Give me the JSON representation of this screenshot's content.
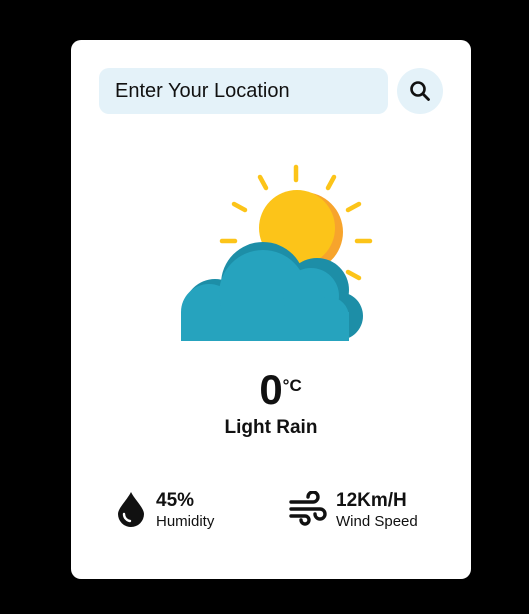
{
  "search": {
    "placeholder": "Enter Your Location",
    "icon": "search-icon"
  },
  "weather": {
    "icon": "partly-cloudy-icon",
    "temperature": "0",
    "unit": "°C",
    "condition": "Light Rain"
  },
  "details": {
    "humidity": {
      "value": "45%",
      "label": "Humidity",
      "icon": "water-drop-icon"
    },
    "wind": {
      "value": "12Km/H",
      "label": "Wind Speed",
      "icon": "wind-icon"
    }
  },
  "colors": {
    "background": "#000000",
    "card": "#ffffff",
    "input_bg": "#e4f2f9",
    "sun": "#fcc419",
    "sun_shade": "#f7a42c",
    "cloud": "#26a3be",
    "cloud_shade": "#1d8ea7"
  }
}
